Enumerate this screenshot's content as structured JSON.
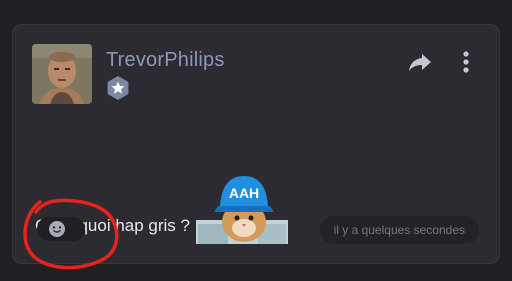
{
  "post": {
    "author": {
      "username": "TrevorPhilips",
      "avatar_icon": "user-avatar-photo",
      "badge_icon": "star-badge-icon"
    },
    "actions": {
      "share_icon": "share-arrow-icon",
      "more_icon": "more-vertical-icon"
    },
    "message": {
      "text": "C’est quoi hap gris ?",
      "sticker_label": "AAH"
    },
    "reaction_icon": "smiley-face-icon",
    "timestamp": "il y a quelques secondes"
  },
  "colors": {
    "background": "#202024",
    "card": "#2b2b31",
    "username": "#8d99b5",
    "text": "#e8e8ec",
    "annotation": "#e8231b",
    "sticker_hat": "#1f8fe0"
  }
}
